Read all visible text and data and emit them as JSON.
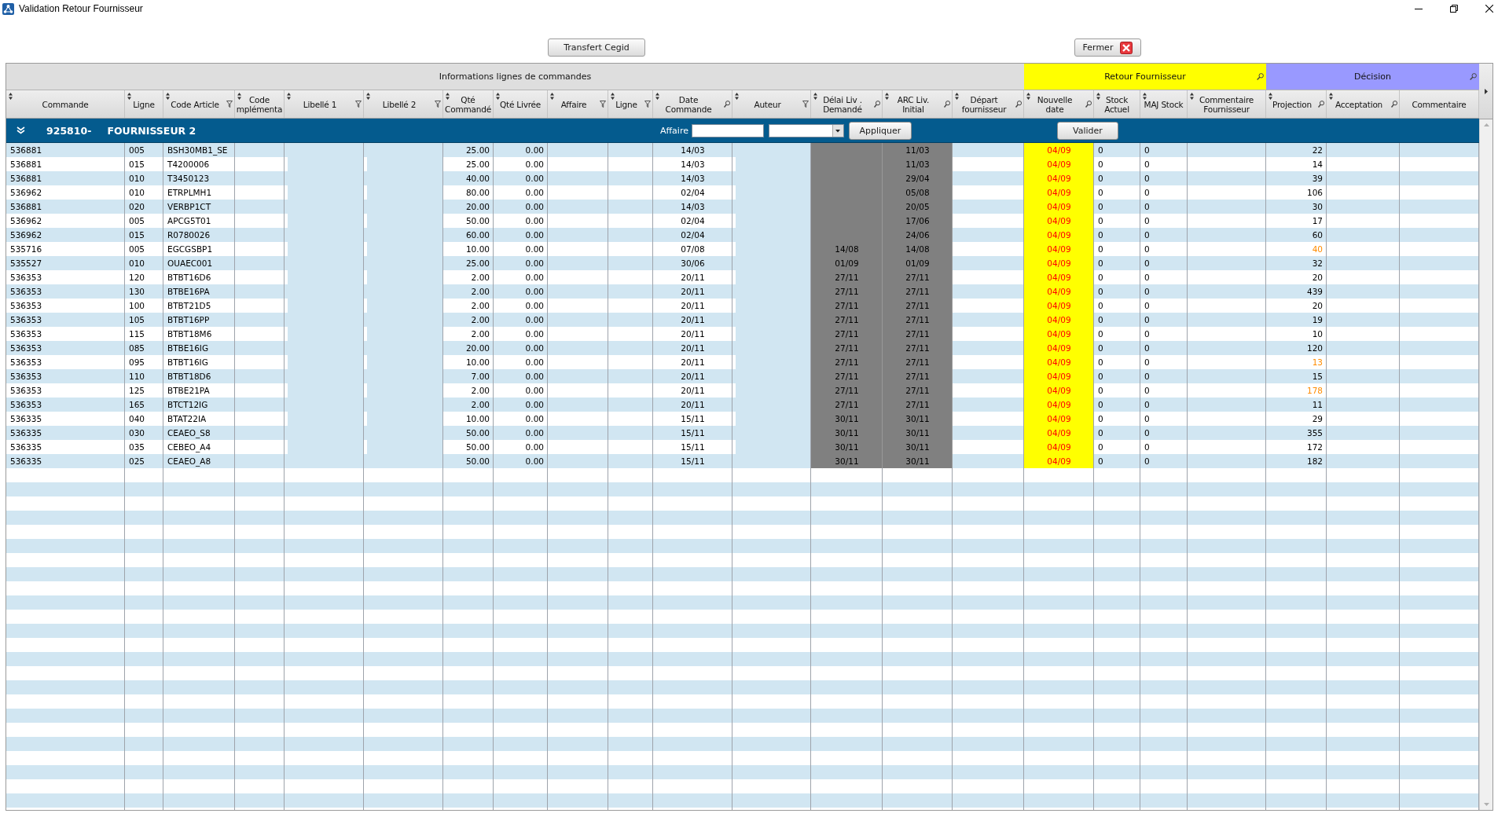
{
  "window": {
    "title": "Validation Retour Fournisseur"
  },
  "toolbar": {
    "buttons": [
      {
        "label": "Transfert Cegid",
        "kind": "plain"
      },
      {
        "label": "Fermer",
        "kind": "close"
      }
    ]
  },
  "table": {
    "column_groups": [
      {
        "label": "Informations lignes de commandes",
        "color": "#dedede",
        "searchable": false,
        "columns": [
          {
            "lines": [
              "Commande"
            ],
            "sortable": true,
            "filterable": false,
            "searchable": false,
            "kind": "text"
          },
          {
            "lines": [
              "Ligne"
            ],
            "sortable": true,
            "filterable": false,
            "searchable": false,
            "kind": "text"
          },
          {
            "lines": [
              "Code Article"
            ],
            "sortable": true,
            "filterable": true,
            "searchable": false,
            "kind": "text"
          },
          {
            "lines": [
              "Code",
              "mplémenta"
            ],
            "sortable": true,
            "filterable": false,
            "searchable": false,
            "kind": "text"
          },
          {
            "lines": [
              "Libellé 1"
            ],
            "sortable": true,
            "filterable": true,
            "searchable": false,
            "kind": "editable"
          },
          {
            "lines": [
              "Libellé 2"
            ],
            "sortable": true,
            "filterable": true,
            "searchable": false,
            "kind": "editable"
          },
          {
            "lines": [
              "Qté",
              "Commandé"
            ],
            "sortable": true,
            "filterable": false,
            "searchable": false,
            "kind": "number"
          },
          {
            "lines": [
              "Qté Livrée"
            ],
            "sortable": true,
            "filterable": false,
            "searchable": false,
            "kind": "number"
          },
          {
            "lines": [
              "Affaire"
            ],
            "sortable": true,
            "filterable": true,
            "searchable": false,
            "kind": "text"
          },
          {
            "lines": [
              "Ligne"
            ],
            "sortable": true,
            "filterable": true,
            "searchable": false,
            "kind": "text"
          },
          {
            "lines": [
              "Date",
              "Commande"
            ],
            "sortable": true,
            "filterable": false,
            "searchable": true,
            "kind": "date"
          },
          {
            "lines": [
              "Auteur"
            ],
            "sortable": true,
            "filterable": true,
            "searchable": false,
            "kind": "editable"
          },
          {
            "lines": [
              "Délai Liv .",
              "Demandé"
            ],
            "sortable": true,
            "filterable": false,
            "searchable": true,
            "kind": "locked"
          },
          {
            "lines": [
              "ARC Liv.",
              "Initial"
            ],
            "sortable": true,
            "filterable": false,
            "searchable": true,
            "kind": "locked"
          },
          {
            "lines": [
              "Départ",
              "fournisseur"
            ],
            "sortable": true,
            "filterable": false,
            "searchable": true,
            "kind": "text"
          }
        ]
      },
      {
        "label": "Retour Fournisseur",
        "color": "#ffff00",
        "searchable": true,
        "columns": [
          {
            "lines": [
              "Nouvelle",
              "date"
            ],
            "sortable": true,
            "filterable": false,
            "searchable": true,
            "kind": "proposal"
          },
          {
            "lines": [
              "Stock",
              "Actuel"
            ],
            "sortable": true,
            "filterable": false,
            "searchable": false,
            "kind": "text"
          },
          {
            "lines": [
              "MAJ Stock"
            ],
            "sortable": true,
            "filterable": false,
            "searchable": false,
            "kind": "text"
          },
          {
            "lines": [
              "Commentaire",
              "Fournisseur"
            ],
            "sortable": true,
            "filterable": false,
            "searchable": false,
            "kind": "text"
          }
        ]
      },
      {
        "label": "Décision",
        "color": "#9999ff",
        "searchable": true,
        "columns": [
          {
            "lines": [
              "Projection"
            ],
            "sortable": true,
            "filterable": false,
            "searchable": true,
            "kind": "number"
          },
          {
            "lines": [
              "Acceptation"
            ],
            "sortable": true,
            "filterable": false,
            "searchable": true,
            "kind": "text"
          },
          {
            "lines": [
              "Commentaire"
            ],
            "sortable": false,
            "filterable": false,
            "searchable": false,
            "kind": "text"
          }
        ]
      }
    ],
    "supplier_group": {
      "expanded": true,
      "code": "925810-",
      "name": "FOURNISSEUR 2",
      "filter_label": "Affaire",
      "apply_button": "Appliquer",
      "validate_button": "Valider"
    },
    "rows": [
      {
        "commande": "536881",
        "ligne": "005",
        "code_article": "BSH30MB1_SE",
        "qte_commandee": "25.00",
        "qte_livree": "0.00",
        "date_commande": "14/03",
        "arc_liv_initial": "11/03",
        "nouvelle_date": "04/09",
        "stock_actuel": "0",
        "maj_stock": "0",
        "projection": "22",
        "projection_warning": false
      },
      {
        "commande": "536881",
        "ligne": "015",
        "code_article": "T4200006",
        "qte_commandee": "25.00",
        "qte_livree": "0.00",
        "date_commande": "14/03",
        "arc_liv_initial": "11/03",
        "nouvelle_date": "04/09",
        "stock_actuel": "0",
        "maj_stock": "0",
        "projection": "14",
        "projection_warning": false
      },
      {
        "commande": "536881",
        "ligne": "010",
        "code_article": "T3450123",
        "qte_commandee": "40.00",
        "qte_livree": "0.00",
        "date_commande": "14/03",
        "arc_liv_initial": "29/04",
        "nouvelle_date": "04/09",
        "stock_actuel": "0",
        "maj_stock": "0",
        "projection": "39",
        "projection_warning": false
      },
      {
        "commande": "536962",
        "ligne": "010",
        "code_article": "ETRPLMH1",
        "qte_commandee": "80.00",
        "qte_livree": "0.00",
        "date_commande": "02/04",
        "arc_liv_initial": "05/08",
        "nouvelle_date": "04/09",
        "stock_actuel": "0",
        "maj_stock": "0",
        "projection": "106",
        "projection_warning": false
      },
      {
        "commande": "536881",
        "ligne": "020",
        "code_article": "VERBP1CT",
        "qte_commandee": "20.00",
        "qte_livree": "0.00",
        "date_commande": "14/03",
        "arc_liv_initial": "20/05",
        "nouvelle_date": "04/09",
        "stock_actuel": "0",
        "maj_stock": "0",
        "projection": "30",
        "projection_warning": false
      },
      {
        "commande": "536962",
        "ligne": "005",
        "code_article": "APCG5T01",
        "qte_commandee": "50.00",
        "qte_livree": "0.00",
        "date_commande": "02/04",
        "arc_liv_initial": "17/06",
        "nouvelle_date": "04/09",
        "stock_actuel": "0",
        "maj_stock": "0",
        "projection": "17",
        "projection_warning": false
      },
      {
        "commande": "536962",
        "ligne": "015",
        "code_article": "R0780026",
        "qte_commandee": "60.00",
        "qte_livree": "0.00",
        "date_commande": "02/04",
        "arc_liv_initial": "24/06",
        "nouvelle_date": "04/09",
        "stock_actuel": "0",
        "maj_stock": "0",
        "projection": "60",
        "projection_warning": false
      },
      {
        "commande": "535716",
        "ligne": "005",
        "code_article": "EGCGSBP1",
        "qte_commandee": "10.00",
        "qte_livree": "0.00",
        "date_commande": "07/08",
        "delai_liv_demande": "14/08",
        "arc_liv_initial": "14/08",
        "nouvelle_date": "04/09",
        "stock_actuel": "0",
        "maj_stock": "0",
        "projection": "40",
        "projection_warning": true
      },
      {
        "commande": "535527",
        "ligne": "010",
        "code_article": "OUAEC001",
        "qte_commandee": "25.00",
        "qte_livree": "0.00",
        "date_commande": "30/06",
        "delai_liv_demande": "01/09",
        "arc_liv_initial": "01/09",
        "nouvelle_date": "04/09",
        "stock_actuel": "0",
        "maj_stock": "0",
        "projection": "32",
        "projection_warning": false
      },
      {
        "commande": "536353",
        "ligne": "120",
        "code_article": "BTBT16D6",
        "qte_commandee": "2.00",
        "qte_livree": "0.00",
        "date_commande": "20/11",
        "delai_liv_demande": "27/11",
        "arc_liv_initial": "27/11",
        "nouvelle_date": "04/09",
        "stock_actuel": "0",
        "maj_stock": "0",
        "projection": "20",
        "projection_warning": false
      },
      {
        "commande": "536353",
        "ligne": "130",
        "code_article": "BTBE16PA",
        "qte_commandee": "2.00",
        "qte_livree": "0.00",
        "date_commande": "20/11",
        "delai_liv_demande": "27/11",
        "arc_liv_initial": "27/11",
        "nouvelle_date": "04/09",
        "stock_actuel": "0",
        "maj_stock": "0",
        "projection": "439",
        "projection_warning": false
      },
      {
        "commande": "536353",
        "ligne": "100",
        "code_article": "BTBT21D5",
        "qte_commandee": "2.00",
        "qte_livree": "0.00",
        "date_commande": "20/11",
        "delai_liv_demande": "27/11",
        "arc_liv_initial": "27/11",
        "nouvelle_date": "04/09",
        "stock_actuel": "0",
        "maj_stock": "0",
        "projection": "20",
        "projection_warning": false
      },
      {
        "commande": "536353",
        "ligne": "105",
        "code_article": "BTBT16PP",
        "qte_commandee": "2.00",
        "qte_livree": "0.00",
        "date_commande": "20/11",
        "delai_liv_demande": "27/11",
        "arc_liv_initial": "27/11",
        "nouvelle_date": "04/09",
        "stock_actuel": "0",
        "maj_stock": "0",
        "projection": "19",
        "projection_warning": false
      },
      {
        "commande": "536353",
        "ligne": "115",
        "code_article": "BTBT18M6",
        "qte_commandee": "2.00",
        "qte_livree": "0.00",
        "date_commande": "20/11",
        "delai_liv_demande": "27/11",
        "arc_liv_initial": "27/11",
        "nouvelle_date": "04/09",
        "stock_actuel": "0",
        "maj_stock": "0",
        "projection": "10",
        "projection_warning": false
      },
      {
        "commande": "536353",
        "ligne": "085",
        "code_article": "BTBE16IG",
        "qte_commandee": "20.00",
        "qte_livree": "0.00",
        "date_commande": "20/11",
        "delai_liv_demande": "27/11",
        "arc_liv_initial": "27/11",
        "nouvelle_date": "04/09",
        "stock_actuel": "0",
        "maj_stock": "0",
        "projection": "120",
        "projection_warning": false
      },
      {
        "commande": "536353",
        "ligne": "095",
        "code_article": "BTBT16IG",
        "qte_commandee": "10.00",
        "qte_livree": "0.00",
        "date_commande": "20/11",
        "delai_liv_demande": "27/11",
        "arc_liv_initial": "27/11",
        "nouvelle_date": "04/09",
        "stock_actuel": "0",
        "maj_stock": "0",
        "projection": "13",
        "projection_warning": true
      },
      {
        "commande": "536353",
        "ligne": "110",
        "code_article": "BTBT18D6",
        "qte_commandee": "7.00",
        "qte_livree": "0.00",
        "date_commande": "20/11",
        "delai_liv_demande": "27/11",
        "arc_liv_initial": "27/11",
        "nouvelle_date": "04/09",
        "stock_actuel": "0",
        "maj_stock": "0",
        "projection": "15",
        "projection_warning": false
      },
      {
        "commande": "536353",
        "ligne": "125",
        "code_article": "BTBE21PA",
        "qte_commandee": "2.00",
        "qte_livree": "0.00",
        "date_commande": "20/11",
        "delai_liv_demande": "27/11",
        "arc_liv_initial": "27/11",
        "nouvelle_date": "04/09",
        "stock_actuel": "0",
        "maj_stock": "0",
        "projection": "178",
        "projection_warning": true
      },
      {
        "commande": "536353",
        "ligne": "165",
        "code_article": "BTCT12IG",
        "qte_commandee": "2.00",
        "qte_livree": "0.00",
        "date_commande": "20/11",
        "delai_liv_demande": "27/11",
        "arc_liv_initial": "27/11",
        "nouvelle_date": "04/09",
        "stock_actuel": "0",
        "maj_stock": "0",
        "projection": "11",
        "projection_warning": false
      },
      {
        "commande": "536335",
        "ligne": "040",
        "code_article": "BTAT22IA",
        "qte_commandee": "10.00",
        "qte_livree": "0.00",
        "date_commande": "15/11",
        "delai_liv_demande": "30/11",
        "arc_liv_initial": "30/11",
        "nouvelle_date": "04/09",
        "stock_actuel": "0",
        "maj_stock": "0",
        "projection": "29",
        "projection_warning": false
      },
      {
        "commande": "536335",
        "ligne": "030",
        "code_article": "CEAEO_S8",
        "qte_commandee": "50.00",
        "qte_livree": "0.00",
        "date_commande": "15/11",
        "delai_liv_demande": "30/11",
        "arc_liv_initial": "30/11",
        "nouvelle_date": "04/09",
        "stock_actuel": "0",
        "maj_stock": "0",
        "projection": "355",
        "projection_warning": false
      },
      {
        "commande": "536335",
        "ligne": "035",
        "code_article": "CEBEO_A4",
        "qte_commandee": "50.00",
        "qte_livree": "0.00",
        "date_commande": "15/11",
        "delai_liv_demande": "30/11",
        "arc_liv_initial": "30/11",
        "nouvelle_date": "04/09",
        "stock_actuel": "0",
        "maj_stock": "0",
        "projection": "172",
        "projection_warning": false
      },
      {
        "commande": "536335",
        "ligne": "025",
        "code_article": "CEAEO_A8",
        "qte_commandee": "50.00",
        "qte_livree": "0.00",
        "date_commande": "15/11",
        "delai_liv_demande": "30/11",
        "arc_liv_initial": "30/11",
        "nouvelle_date": "04/09",
        "stock_actuel": "0",
        "maj_stock": "0",
        "projection": "182",
        "projection_warning": false
      }
    ]
  }
}
